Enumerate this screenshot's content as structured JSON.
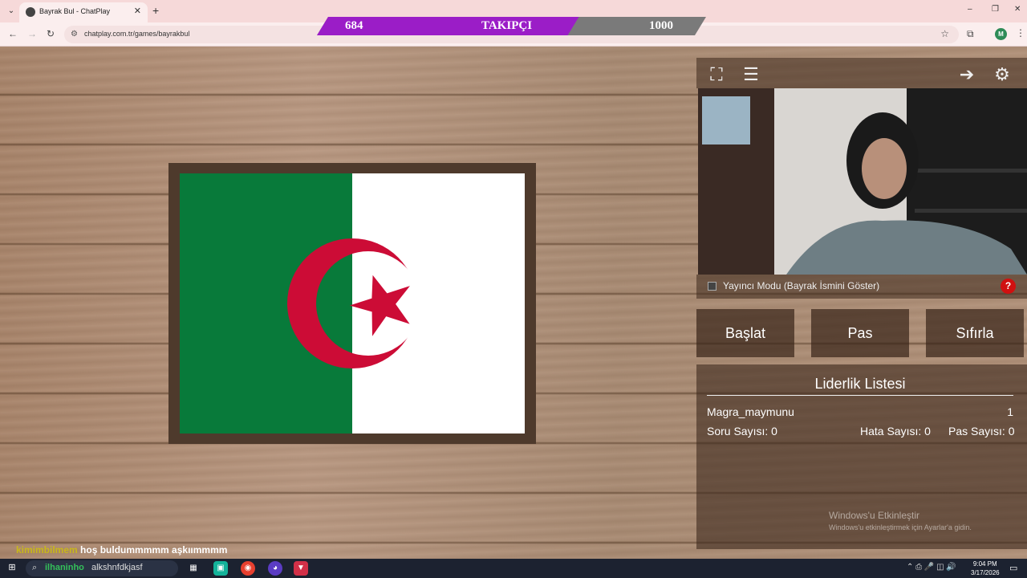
{
  "browser": {
    "tab_title": "Bayrak Bul - ChatPlay",
    "tab_close": "✕",
    "new_tab": "+",
    "url": "chatplay.com.tr/games/bayrakbul",
    "profile_initial": "M",
    "window_controls": [
      "–",
      "❐",
      "✕"
    ]
  },
  "follower_bar": {
    "current": "684",
    "label": "TAKIPÇI",
    "goal": "1000",
    "progress_fraction": 0.684,
    "fill_color": "#9b1dc7",
    "empty_color": "#7a7a7a"
  },
  "flag": {
    "country": "Algeria",
    "green": "#087a3a",
    "white": "#ffffff",
    "red": "#cc0c36"
  },
  "panel": {
    "streamer_mode_label": "Yayıncı Modu (Bayrak İsmini Göster)",
    "help_label": "?",
    "buttons": {
      "start": "Başlat",
      "pass": "Pas",
      "reset": "Sıfırla"
    },
    "leaderboard": {
      "title": "Liderlik Listesi",
      "entries": [
        {
          "name": "Magra_maymunu",
          "score": "1"
        }
      ],
      "question_count": "Soru Sayısı: 0",
      "error_count": "Hata Sayısı: 0",
      "pass_count": "Pas Sayısı: 0"
    }
  },
  "windows_watermark": {
    "title": "Windows'u Etkinleştir",
    "subtitle": "Windows'u etkinleştirmek için Ayarlar'a gidin."
  },
  "chat_overlay": {
    "user": "kimimbilmem",
    "message": "hoş buldummmmm aşkıımmmm"
  },
  "taskbar": {
    "search_user": "ilhaninho",
    "search_text": "alkshnfdkjasf",
    "time": "9:04 PM",
    "date": "3/17/2026"
  }
}
